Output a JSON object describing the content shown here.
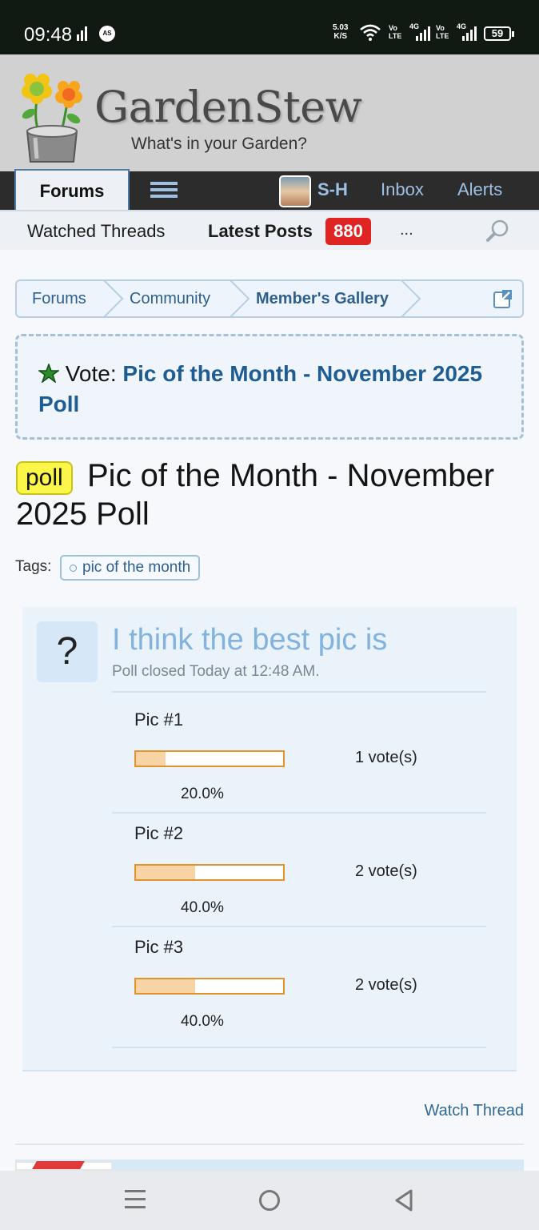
{
  "status_bar": {
    "time": "09:48",
    "speed_value": "5.03",
    "speed_unit": "K/S",
    "net1_a": "Vo",
    "net1_b": "LTE",
    "net1_gen": "4G",
    "net2_a": "Vo",
    "net2_b": "LTE",
    "net2_gen": "4G",
    "battery": "59",
    "icons": [
      "signal-icon",
      "app-notification-icon",
      "wifi-icon",
      "mobile-signal-icon",
      "battery-icon"
    ]
  },
  "site": {
    "name": "GardenStew",
    "tagline": "What's in your Garden?"
  },
  "nav": {
    "tab_forums": "Forums",
    "user": "S-H",
    "inbox": "Inbox",
    "alerts": "Alerts"
  },
  "subnav": {
    "watched": "Watched Threads",
    "latest": "Latest Posts",
    "latest_count": "880",
    "more": "..."
  },
  "breadcrumb": {
    "items": [
      "Forums",
      "Community",
      "Member's Gallery"
    ]
  },
  "notice": {
    "prefix": "Vote:",
    "link": "Pic of the Month - November 2025 Poll"
  },
  "thread": {
    "prefix": "poll",
    "title": "Pic of the Month - November 2025 Poll",
    "tags_label": "Tags:",
    "tag": "pic of the month"
  },
  "poll": {
    "question_icon": "?",
    "question": "I think the best pic is",
    "status": "Poll closed Today at 12:48 AM.",
    "options": [
      {
        "label": "Pic #1",
        "votes": "1 vote(s)",
        "percent": "20.0%",
        "fraction": 0.2
      },
      {
        "label": "Pic #2",
        "votes": "2 vote(s)",
        "percent": "40.0%",
        "fraction": 0.4
      },
      {
        "label": "Pic #3",
        "votes": "2 vote(s)",
        "percent": "40.0%",
        "fraction": 0.4
      }
    ],
    "colors": {
      "bar_border": "#e1942c",
      "bar_fill": "#f8d3a5"
    }
  },
  "actions": {
    "watch_thread": "Watch Thread"
  }
}
